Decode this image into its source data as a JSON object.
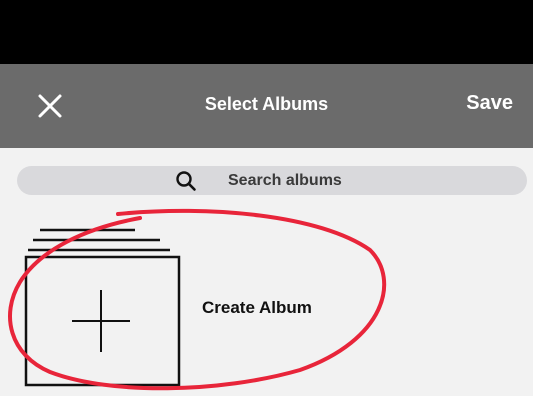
{
  "header": {
    "title": "Select Albums",
    "save_label": "Save",
    "close_icon": "close-icon"
  },
  "search": {
    "placeholder": "Search albums",
    "icon": "search-icon"
  },
  "albums": {
    "create_label": "Create Album",
    "create_icon": "plus-icon"
  },
  "colors": {
    "status_bar": "#000000",
    "nav_bar": "#6b6b6b",
    "background": "#f2f2f2",
    "search_bg": "#d9d9dc",
    "annotation": "#e8253a"
  }
}
